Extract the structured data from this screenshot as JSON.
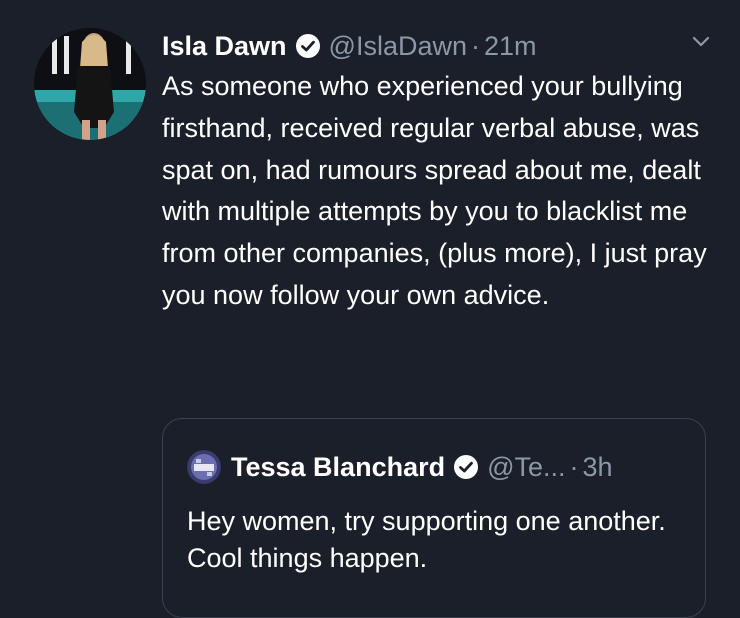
{
  "tweet": {
    "author_name": "Isla Dawn",
    "author_handle": "@IslaDawn",
    "separator": "·",
    "time": "21m",
    "text": "As someone who experienced your bullying firsthand, received regular verbal abuse, was spat on, had rumours spread about me, dealt with multiple attempts by you to blacklist me from other companies, (plus more), I just pray you now follow your own advice."
  },
  "quoted_tweet": {
    "author_name": "Tessa Blanchard",
    "author_handle": "@Te...",
    "separator": "·",
    "time": "3h",
    "text": "Hey women, try supporting one another. Cool things happen."
  },
  "icons": {
    "verified": "verified-badge-icon",
    "menu": "chevron-down-icon"
  },
  "colors": {
    "background": "#1b1f29",
    "text_primary": "#ffffff",
    "text_secondary": "#8b98a5",
    "border": "#38414d"
  }
}
